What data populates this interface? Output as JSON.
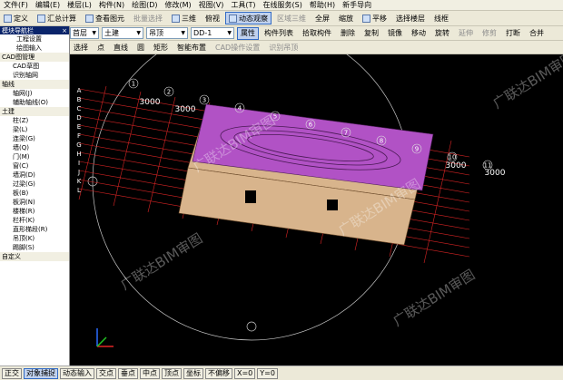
{
  "menu": [
    "文件(F)",
    "编辑(E)",
    "楼层(L)",
    "构件(N)",
    "绘图(D)",
    "修改(M)",
    "视图(V)",
    "工具(T)",
    "在线服务(S)",
    "帮助(H)",
    "新手导向"
  ],
  "toolbar1": {
    "define": "定义",
    "sum": "汇总计算",
    "view": "查看图元",
    "batch": "批量选择",
    "three_d": "三维",
    "plan": "俯视",
    "dynamic": "动态观察",
    "region": "区域三维",
    "full": "全屏",
    "zoom_out": "缩放",
    "pan": "平移",
    "floor_sel": "选择楼层",
    "line": "线框"
  },
  "toolbar2": {
    "floor": "首层",
    "category": "土建",
    "subtype": "吊顶",
    "element": "DD-1",
    "attr": "属性",
    "list": "构件列表",
    "pick": "拾取构件",
    "delete": "删除",
    "copy": "复制",
    "mirror": "镜像",
    "move": "移动",
    "rotate": "旋转",
    "extend": "延伸",
    "trim": "修剪",
    "break": "打断",
    "merge": "合并"
  },
  "toolbar3": {
    "select": "选择",
    "point": "点",
    "line": "直线",
    "arc": "圆",
    "rect": "矩形",
    "auto": "智能布置",
    "cad_ops": "CAD操作设置",
    "identify": "识别吊顶"
  },
  "panel": {
    "title": "模块导航栏",
    "project_settings": "工程设置",
    "draw_input": "绘图输入",
    "tree": [
      {
        "label": "CAD图管理",
        "group": true
      },
      {
        "label": "CAD草图",
        "group": false
      },
      {
        "label": "识别轴网",
        "group": false
      },
      {
        "label": "轴线",
        "group": true
      },
      {
        "label": "轴网(J)",
        "group": false
      },
      {
        "label": "辅助轴线(O)",
        "group": false
      },
      {
        "label": "土建",
        "group": true
      },
      {
        "label": "柱(Z)",
        "group": false
      },
      {
        "label": "梁(L)",
        "group": false
      },
      {
        "label": "连梁(G)",
        "group": false
      },
      {
        "label": "墙(Q)",
        "group": false
      },
      {
        "label": "门(M)",
        "group": false
      },
      {
        "label": "窗(C)",
        "group": false
      },
      {
        "label": "墙洞(D)",
        "group": false
      },
      {
        "label": "过梁(G)",
        "group": false
      },
      {
        "label": "板(B)",
        "group": false
      },
      {
        "label": "板洞(N)",
        "group": false
      },
      {
        "label": "楼梯(R)",
        "group": false
      },
      {
        "label": "栏杆(K)",
        "group": false
      },
      {
        "label": "直形梯段(R)",
        "group": false
      },
      {
        "label": "吊顶(K)",
        "group": false
      },
      {
        "label": "踢脚(S)",
        "group": false
      },
      {
        "label": "自定义",
        "group": true
      }
    ]
  },
  "dims": [
    "3000",
    "3000",
    "3000",
    "3000"
  ],
  "axis_nums": [
    "1",
    "2",
    "3",
    "4",
    "5",
    "6",
    "7",
    "8",
    "9",
    "10",
    "11"
  ],
  "axis_letters": [
    "A",
    "B",
    "C",
    "D",
    "E",
    "F",
    "G",
    "H",
    "I",
    "J",
    "K",
    "L"
  ],
  "watermark": "广联达BIM审图",
  "status": {
    "ortho": "正交",
    "snap": "对象捕捉",
    "dynamic_input": "动态输入",
    "angle": "交点",
    "midpoint": "垂点",
    "center": "中点",
    "vertex": "顶点",
    "coord": "坐标",
    "sel_count": "不偏移",
    "x": "X=0",
    "y": "Y=0"
  },
  "colors": {
    "canvas": "#000000",
    "roof": "#b152c5",
    "wall": "#d8b48c",
    "grid": "#d62424",
    "axis_line": "#c8c8c8"
  }
}
